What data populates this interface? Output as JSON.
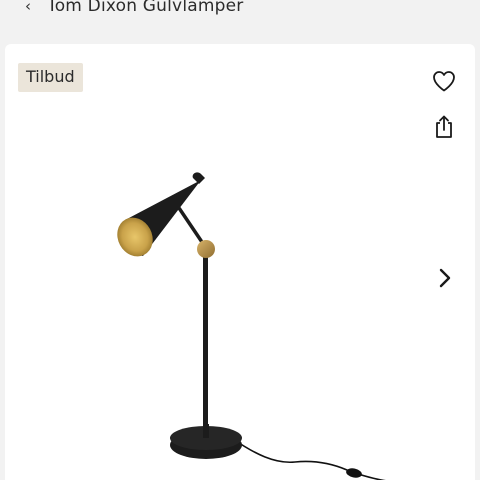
{
  "header": {
    "back_glyph": "‹",
    "title": "Tom Dixon Gulvlamper"
  },
  "product": {
    "badge": "Tilbud",
    "image_icon": "floor-lamp-photo"
  },
  "actions": {
    "favorite_icon": "heart-icon",
    "share_icon": "share-icon",
    "next_icon": "chevron-right-icon"
  },
  "colors": {
    "background": "#f2f2f2",
    "card": "#ffffff",
    "badge_bg": "#ebe5da",
    "lamp_black": "#1c1c1c",
    "lamp_brass": "#c9a24a"
  }
}
